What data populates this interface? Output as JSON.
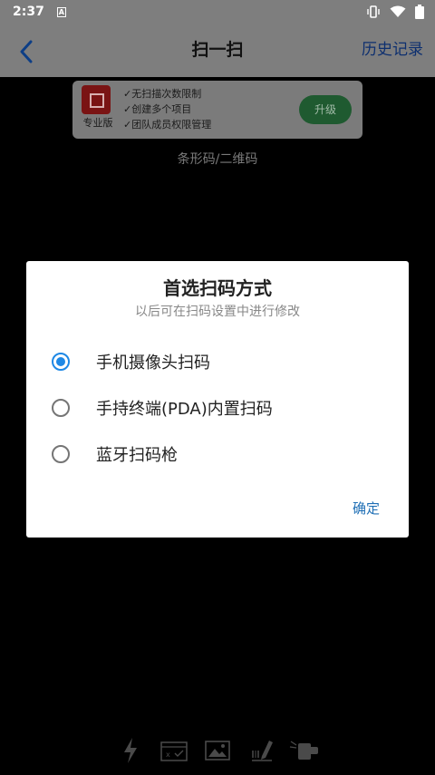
{
  "status_bar": {
    "time": "2:37",
    "notification_icon": "A",
    "icons": [
      "vibrate-icon",
      "wifi-icon",
      "battery-icon"
    ]
  },
  "app_bar": {
    "title": "扫一扫",
    "history_label": "历史记录",
    "back_icon": "chevron-left-icon"
  },
  "promo": {
    "tag": "专业版",
    "features": [
      "✓无扫描次数限制",
      "✓创建多个项目",
      "✓团队成员权限管理"
    ],
    "upgrade_label": "升级"
  },
  "scan_mode_label": "条形码/二维码",
  "dialog": {
    "title": "首选扫码方式",
    "subtitle": "以后可在扫码设置中进行修改",
    "options": [
      {
        "label": "手机摄像头扫码",
        "selected": true
      },
      {
        "label": "手持终端(PDA)内置扫码",
        "selected": false
      },
      {
        "label": "蓝牙扫码枪",
        "selected": false
      }
    ],
    "confirm_label": "确定"
  },
  "bottom_tools": [
    "flash-icon",
    "batch-scan-icon",
    "gallery-icon",
    "manual-input-icon",
    "pda-scanner-icon"
  ],
  "colors": {
    "accent": "#1e88e5",
    "confirm_text": "#1f6fb5",
    "overlay_bar": "#7e7e7e"
  }
}
